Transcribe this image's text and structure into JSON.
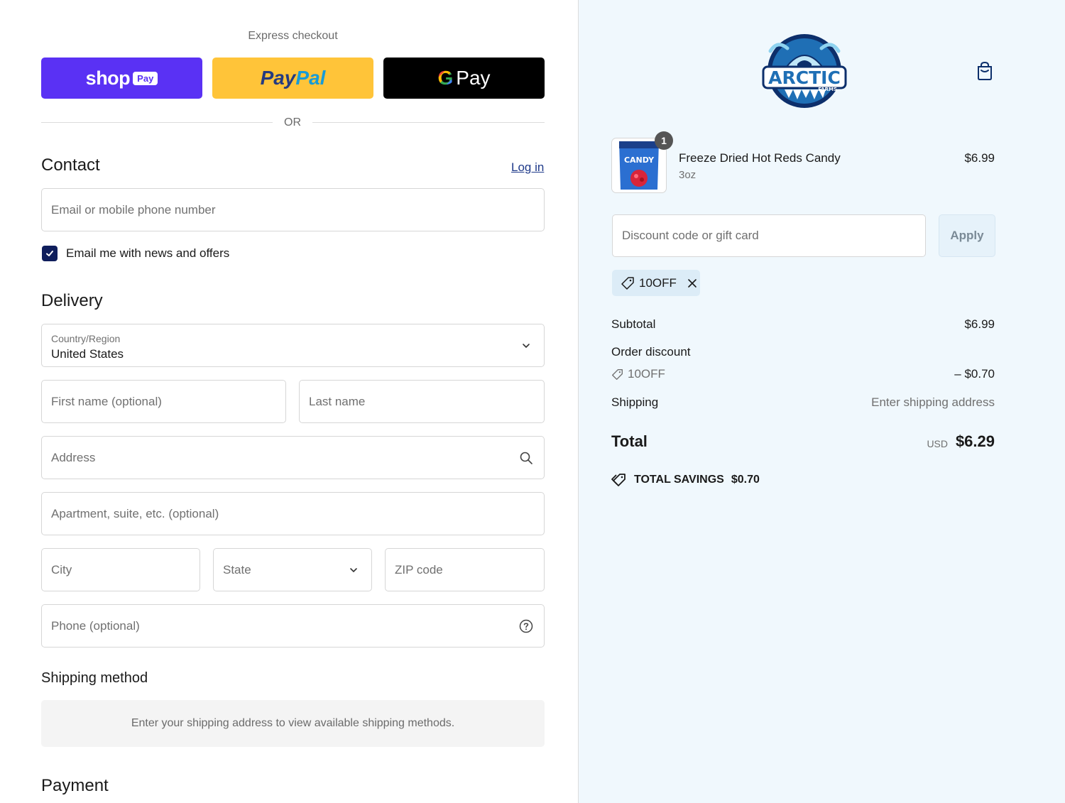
{
  "express_checkout": {
    "title": "Express checkout",
    "shop_pay": {
      "brand": "shop",
      "pay": "Pay"
    },
    "paypal": {
      "part1": "Pay",
      "part2": "Pal"
    },
    "gpay": {
      "g": "G",
      "pay": "Pay"
    },
    "divider": "OR"
  },
  "contact": {
    "heading": "Contact",
    "login": "Log in",
    "email_placeholder": "Email or mobile phone number",
    "newsletter_label": "Email me with news and offers",
    "newsletter_checked": true
  },
  "delivery": {
    "heading": "Delivery",
    "country_label": "Country/Region",
    "country_value": "United States",
    "first_name_placeholder": "First name (optional)",
    "last_name_placeholder": "Last name",
    "address_placeholder": "Address",
    "apartment_placeholder": "Apartment, suite, etc. (optional)",
    "city_placeholder": "City",
    "state_placeholder": "State",
    "zip_placeholder": "ZIP code",
    "phone_placeholder": "Phone (optional)"
  },
  "shipping_method": {
    "heading": "Shipping method",
    "message": "Enter your shipping address to view available shipping methods."
  },
  "payment": {
    "heading": "Payment"
  },
  "summary": {
    "brand": "ARCTIC",
    "brand_sub": "FARMS",
    "product": {
      "name": "Freeze Dried Hot Reds Candy",
      "variant": "3oz",
      "price": "$6.99",
      "quantity": "1",
      "thumb_label": "CANDY"
    },
    "discount_placeholder": "Discount code or gift card",
    "apply_label": "Apply",
    "applied_code": "10OFF",
    "subtotal_label": "Subtotal",
    "subtotal_value": "$6.99",
    "order_discount_label": "Order discount",
    "discount_code": "10OFF",
    "discount_value": "– $0.70",
    "shipping_label": "Shipping",
    "shipping_value": "Enter shipping address",
    "total_label": "Total",
    "currency": "USD",
    "total_value": "$6.29",
    "savings_label": "TOTAL SAVINGS",
    "savings_value": "$0.70"
  },
  "colors": {
    "shop_pay": "#5a31f4",
    "paypal": "#ffc439",
    "gpay": "#000000",
    "summary_bg": "#f0f8fd",
    "checkbox": "#0f1e5c"
  }
}
